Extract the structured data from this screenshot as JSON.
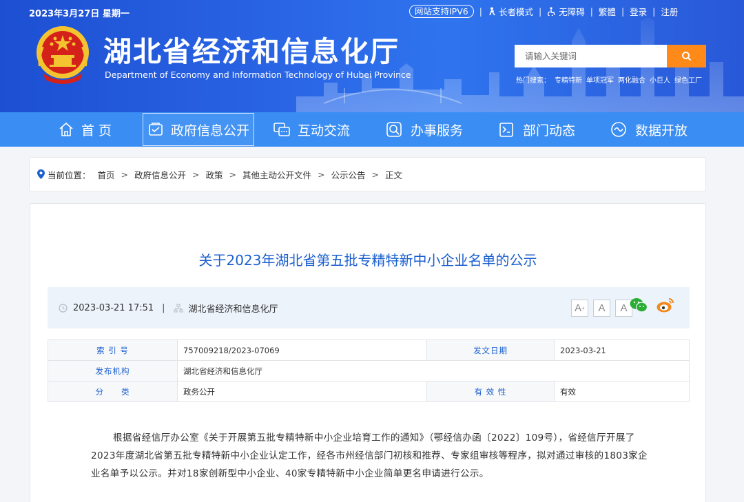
{
  "header": {
    "date": "2023年3月27日 星期一",
    "ipv6": "网站支持IPV6",
    "elder": "长者模式",
    "accessible": "无障碍",
    "traditional": "繁體",
    "login": "登录",
    "register": "注册",
    "site_title": "湖北省经济和信息化厅",
    "site_en": "Department of Economy and Information Technology of Hubei Province",
    "search_placeholder": "请输入关键词",
    "hot_label": "热门搜索：",
    "hot_items": [
      "专精特新",
      "单项冠军",
      "两化融合",
      "小巨人",
      "绿色工厂"
    ]
  },
  "nav": {
    "items": [
      {
        "label": "首 页",
        "icon": "home-icon"
      },
      {
        "label": "政府信息公开",
        "icon": "document-check-icon"
      },
      {
        "label": "互动交流",
        "icon": "chat-icon"
      },
      {
        "label": "办事服务",
        "icon": "service-search-icon"
      },
      {
        "label": "部门动态",
        "icon": "news-icon"
      },
      {
        "label": "数据开放",
        "icon": "data-wave-icon"
      }
    ],
    "active_index": 1
  },
  "breadcrumb": {
    "label": "当前位置：",
    "items": [
      "首页",
      "政府信息公开",
      "政策",
      "其他主动公开文件",
      "公示公告",
      "正文"
    ]
  },
  "article": {
    "title": "关于2023年湖北省第五批专精特新中小企业名单的公示",
    "datetime": "2023-03-21 17:51",
    "source": "湖北省经济和信息化厅",
    "font_buttons": [
      "A+",
      "A",
      "A-"
    ],
    "info": {
      "index_label": "索 引 号",
      "index_value": "757009218/2023-07069",
      "date_label": "发文日期",
      "date_value": "2023-03-21",
      "org_label": "发布机构",
      "org_value": "湖北省经济和信息化厅",
      "category_label": "分　　类",
      "category_value": "政务公开",
      "validity_label": "有 效 性",
      "validity_value": "有效"
    },
    "paragraph": "根据省经信厅办公室《关于开展第五批专精特新中小企业培育工作的通知》（鄂经信办函〔2022〕109号），省经信厅开展了2023年度湖北省第五批专精特新中小企业认定工作，经各市州经信部门初核和推荐、专家组审核等程序，拟对通过审核的1803家企业名单予以公示。并对18家创新型中小企业、40家专精特新中小企业简单更名申请进行公示。"
  },
  "colors": {
    "header_blue": "#2a66e6",
    "nav_blue": "#3a8df2",
    "title_blue": "#1b5fcf",
    "search_orange": "#ff8a1a",
    "wechat_green": "#2aae36",
    "weibo_orange": "#f0891e"
  }
}
